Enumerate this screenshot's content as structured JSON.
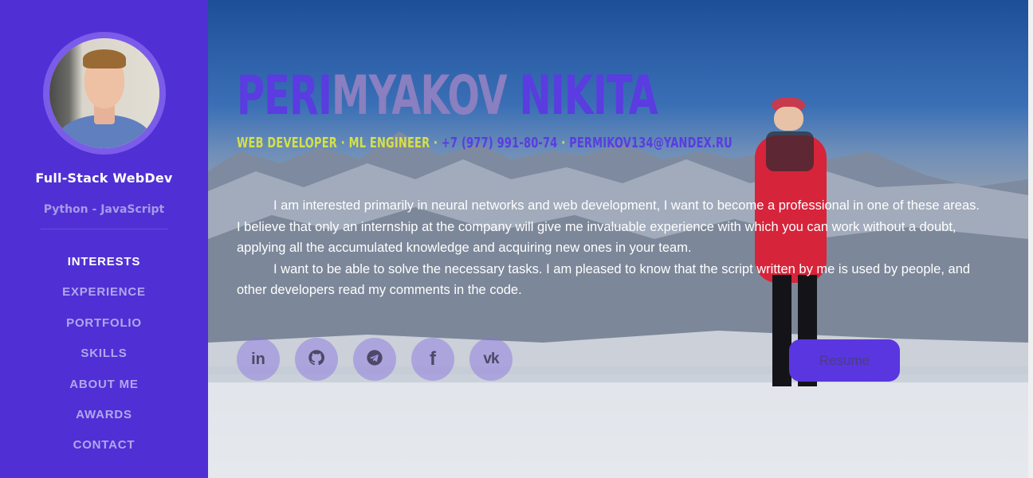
{
  "sidebar": {
    "role": "Full-Stack WebDev",
    "langs": "Python - JavaScript",
    "nav": [
      "INTERESTS",
      "EXPERIENCE",
      "PORTFOLIO",
      "SKILLS",
      "ABOUT ME",
      "AWARDS",
      "CONTACT"
    ],
    "active": "INTERESTS"
  },
  "hero": {
    "name_part1": "PERI",
    "name_part2": "MYAKOV",
    "name_part3": "NIKITA",
    "title": "WEB DEVELOPER · ML ENGINEER ·",
    "phone": "+7 (977) 991-80-74",
    "separator": "·",
    "email": "PERMIKOV134@YANDEX.RU",
    "paragraph1": "I am interested primarily in neural networks and web development, I want to become a professional in one of these areas. I believe that only an internship at the company will give me invaluable experience with which you can work without a doubt, applying all the accumulated knowledge and acquiring new ones in your team.",
    "paragraph2": "I want to be able to solve the necessary tasks. I am pleased to know that the script written by me is used by people, and other developers read my comments in the code.",
    "resume_label": "Resume"
  },
  "socials": [
    {
      "icon": "linkedin-icon",
      "glyph": "in"
    },
    {
      "icon": "github-icon",
      "glyph": ""
    },
    {
      "icon": "telegram-icon",
      "glyph": ""
    },
    {
      "icon": "facebook-icon",
      "glyph": "f"
    },
    {
      "icon": "vk-icon",
      "glyph": "vk"
    }
  ],
  "colors": {
    "sidebar": "#5030d4",
    "accent": "#5a3ce0",
    "yellow": "#d4e04a"
  }
}
